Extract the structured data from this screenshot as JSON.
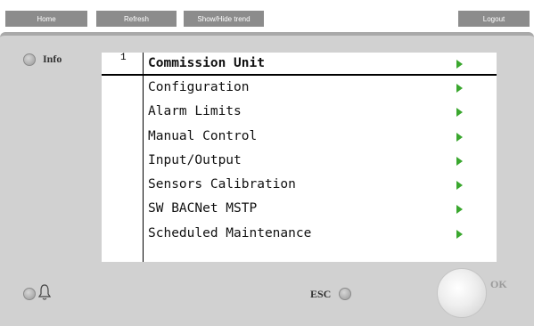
{
  "toolbar": {
    "home": "Home",
    "refresh": "Refresh",
    "trend": "Show/Hide trend",
    "logout": "Logout"
  },
  "panel": {
    "info_label": "Info",
    "page_number": "1",
    "esc_label": "ESC",
    "ok_label": "OK"
  },
  "menu": {
    "items": [
      {
        "label": "Commission Unit",
        "selected": true
      },
      {
        "label": "Configuration"
      },
      {
        "label": "Alarm Limits"
      },
      {
        "label": "Manual Control"
      },
      {
        "label": "Input/Output"
      },
      {
        "label": "Sensors Calibration"
      },
      {
        "label": "SW BACNet MSTP"
      },
      {
        "label": "Scheduled Maintenance"
      }
    ]
  },
  "colors": {
    "toolbar_button": "#8c8c8c",
    "panel": "#d1d1d1",
    "arrow": "#3aa72e"
  },
  "icons": [
    "bell-icon",
    "arrow-right-icon"
  ]
}
